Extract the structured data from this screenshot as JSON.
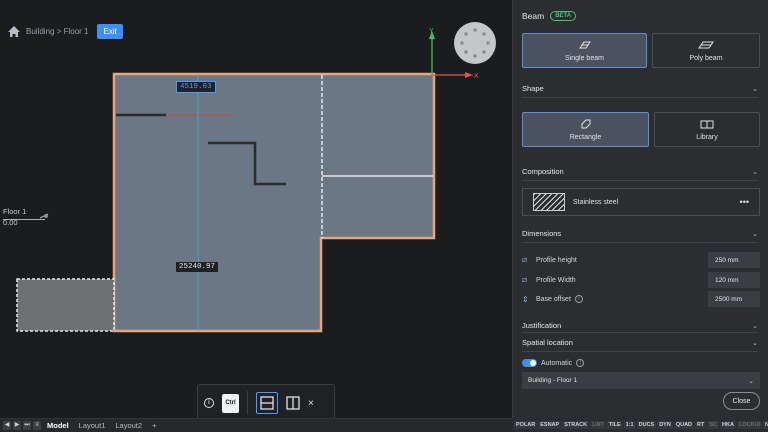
{
  "breadcrumb": {
    "path": "Building > Floor 1",
    "exit_label": "Exit"
  },
  "viewport": {
    "axis_x_label": "X",
    "axis_y_label": "Y",
    "floor_name": "Floor 1",
    "floor_elevation": "0.00",
    "dim_active": "4519.03",
    "dim_length": "25240.97"
  },
  "floating_toolbar": {
    "ctrl_label": "Ctrl",
    "close_label": "×",
    "info_label": "i"
  },
  "bottom_bar": {
    "tabs": [
      "Model",
      "Layout1",
      "Layout2"
    ],
    "add_label": "+",
    "nav": [
      "◀",
      "▶",
      "⏭"
    ]
  },
  "status_bar": {
    "items": [
      {
        "label": "POLAR",
        "on": true
      },
      {
        "label": "ESNAP",
        "on": true
      },
      {
        "label": "STRACK",
        "on": true
      },
      {
        "label": "LWT",
        "on": false
      },
      {
        "label": "TILE",
        "on": true
      },
      {
        "label": "1:1",
        "on": true
      },
      {
        "label": "DUCS",
        "on": true
      },
      {
        "label": "DYN",
        "on": true
      },
      {
        "label": "QUAD",
        "on": true
      },
      {
        "label": "RT",
        "on": true
      },
      {
        "label": "SC",
        "on": false
      },
      {
        "label": "HKA",
        "on": true
      },
      {
        "label": "LOCKUI",
        "on": false
      },
      {
        "label": "None",
        "on": true
      }
    ]
  },
  "panel": {
    "title": "Beam",
    "badge": "BETA",
    "beam_types": [
      {
        "label": "Single beam",
        "icon": "single-beam-icon"
      },
      {
        "label": "Poly beam",
        "icon": "poly-beam-icon"
      }
    ],
    "shape_header": "Shape",
    "shapes": [
      {
        "label": "Rectangle",
        "icon": "rectangle-icon"
      },
      {
        "label": "Library",
        "icon": "library-icon"
      }
    ],
    "composition_header": "Composition",
    "composition_name": "Stainless steel",
    "composition_more": "•••",
    "dimensions_header": "Dimensions",
    "dimensions": [
      {
        "label": "Profile height",
        "value": "250 mm"
      },
      {
        "label": "Profile Width",
        "value": "120 mm"
      },
      {
        "label": "Base offset",
        "value": "2500 mm"
      }
    ],
    "justification_header": "Justification",
    "spatial_header": "Spatial location",
    "automatic_label": "Automatic",
    "location_value": "Building - Floor 1",
    "close_label": "Close"
  },
  "colors": {
    "accent": "#3d8ff5",
    "slab": "#6b7785",
    "outline": "#e8a57a",
    "beta": "#44c17a"
  }
}
